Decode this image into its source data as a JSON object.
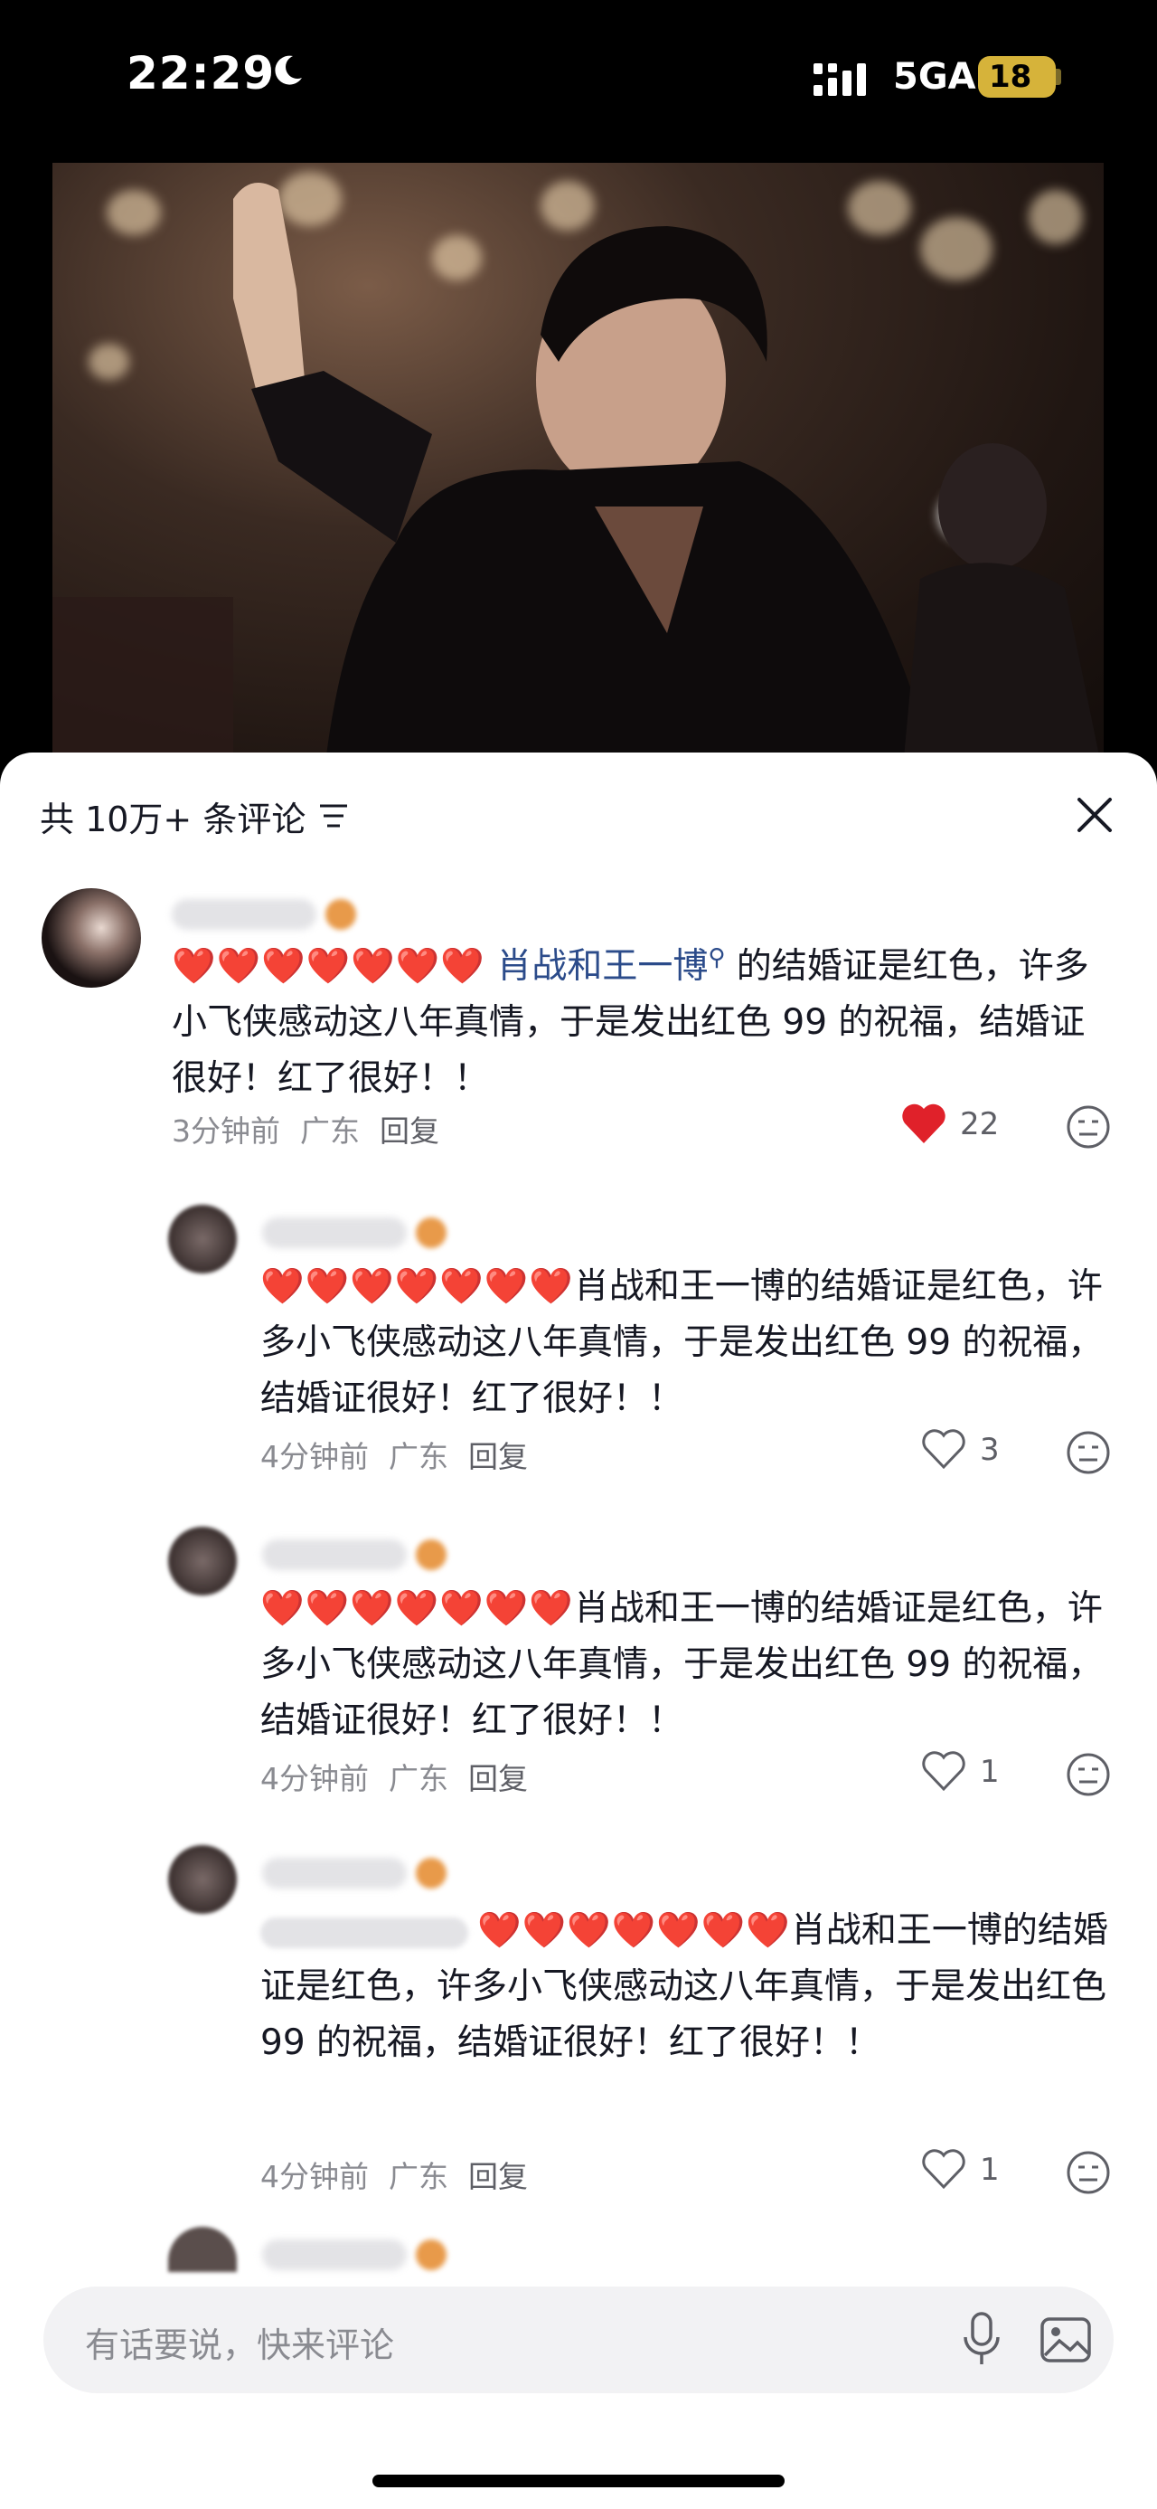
{
  "status_bar": {
    "time": "22:29",
    "network": "5GA",
    "battery": "18",
    "icons": [
      "moon-icon",
      "signal-icon",
      "battery-icon"
    ]
  },
  "comments_sheet": {
    "header": "共 10万+ 条评论",
    "comments": [
      {
        "hearts": "❤️❤️❤️❤️❤️❤️❤️",
        "link_text": "肖战和王一博",
        "text": "的结婚证是红色，许多小飞侠感动这八年真情，于是发出红色 99 的祝福，结婚证很好！红了很好！！",
        "time": "3分钟前",
        "location": "广东",
        "reply": "回复",
        "likes": "22",
        "liked": true
      },
      {
        "hearts": "❤️❤️❤️❤️❤️❤️❤️",
        "text": "肖战和王一博的结婚证是红色，许多小飞侠感动这八年真情，于是发出红色 99 的祝福，结婚证很好！红了很好！！",
        "time": "4分钟前",
        "location": "广东",
        "reply": "回复",
        "likes": "3",
        "liked": false
      },
      {
        "hearts": "❤️❤️❤️❤️❤️❤️❤️",
        "text": "肖战和王一博的结婚证是红色，许多小飞侠感动这八年真情，于是发出红色 99 的祝福，结婚证很好！红了很好！！",
        "time": "4分钟前",
        "location": "广东",
        "reply": "回复",
        "likes": "1",
        "liked": false
      },
      {
        "hearts": "❤️❤️❤️❤️❤️❤️❤️",
        "text": "肖战和王一博的结婚证是红色，许多小飞侠感动这八年真情，于是发出红色 99 的祝福，结婚证很好！红了很好！！",
        "time": "4分钟前",
        "location": "广东",
        "reply": "回复",
        "likes": "1",
        "liked": false
      }
    ]
  },
  "input_bar": {
    "placeholder": "有话要说，快来评论"
  },
  "colors": {
    "heart_red": "#e0212a",
    "link_blue": "#2b4b8a",
    "meta_gray": "#8a8b91",
    "battery_yellow": "#d6b33a"
  }
}
